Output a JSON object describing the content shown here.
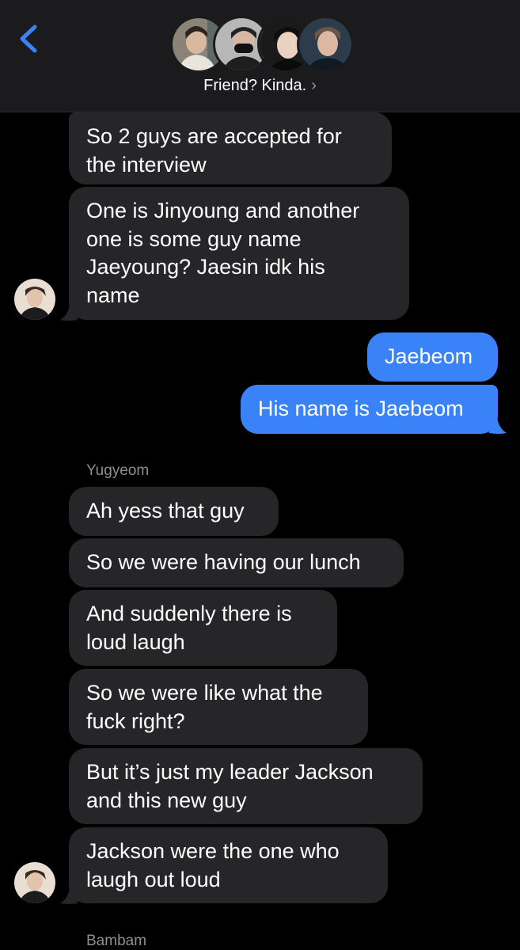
{
  "header": {
    "back_icon": "chevron-left-icon",
    "group_name": "Friend? Kinda.",
    "chevron": "›",
    "accent": "#3a82f7"
  },
  "messages": [
    {
      "side": "in",
      "text_lines": [
        "So 2 guys are accepted for",
        "the interview"
      ]
    },
    {
      "side": "in",
      "text_lines": [
        "One is Jinyoung and another",
        "one is some guy name",
        "Jaeyoung? Jaesin idk his",
        "name"
      ]
    },
    {
      "side": "out",
      "text_lines": [
        "Jaebeom"
      ]
    },
    {
      "side": "out",
      "text_lines": [
        "His name is Jaebeom"
      ]
    },
    {
      "sender": "Yugyeom"
    },
    {
      "side": "in",
      "text_lines": [
        "Ah yess that guy"
      ]
    },
    {
      "side": "in",
      "text_lines": [
        "So we were having our lunch"
      ]
    },
    {
      "side": "in",
      "text_lines": [
        "And suddenly there is",
        "loud laugh"
      ]
    },
    {
      "side": "in",
      "text_lines": [
        "So we were like what the",
        "fuck right?"
      ]
    },
    {
      "side": "in",
      "text_lines": [
        "But it’s just my leader Jackson",
        "and this new guy"
      ]
    },
    {
      "side": "in",
      "text_lines": [
        "Jackson were the one who",
        "laugh out loud"
      ]
    },
    {
      "sender": "Bambam"
    }
  ],
  "colors": {
    "background": "#000000",
    "incoming_bubble": "#262628",
    "outgoing_bubble": "#3a82f7",
    "sender_label": "#8e8e93"
  }
}
